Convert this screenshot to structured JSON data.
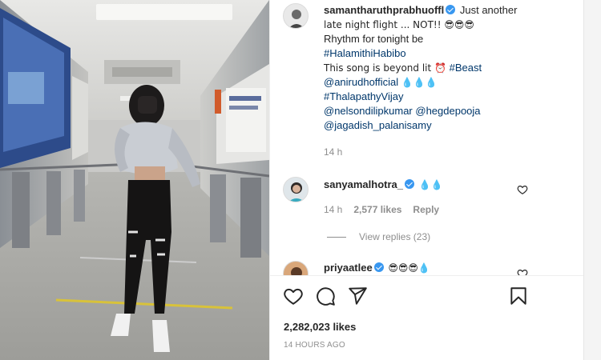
{
  "post": {
    "author": "samantharuthprabhuoffl",
    "caption_lines": [
      {
        "type": "text",
        "text": "Just another"
      },
      {
        "type": "text",
        "text": "late night flight ... NOT!! 😎😎😎"
      },
      {
        "type": "text",
        "text": "Rhythm for tonight be"
      },
      {
        "type": "tag",
        "text": "#HalamithiHabibo"
      },
      {
        "type": "text",
        "text": "This song is beyond lit ⏰"
      },
      {
        "type": "tag",
        "text": "#Beast"
      },
      {
        "type": "tag",
        "text": "@anirudhofficial"
      },
      {
        "type": "text",
        "text": "💧💧💧"
      },
      {
        "type": "tag",
        "text": "#ThalapathyVijay"
      },
      {
        "type": "tag",
        "text": "@nelsondilipkumar"
      },
      {
        "type": "tag",
        "text": "@hegdepooja"
      },
      {
        "type": "tag",
        "text": "@jagadish_palanisamy"
      }
    ],
    "posted_ago": "14 h"
  },
  "comments": [
    {
      "username": "sanyamalhotra_",
      "text": "💧💧",
      "time": "14 h",
      "likes": "2,577 likes",
      "reply_label": "Reply",
      "view_replies": "View replies (23)"
    },
    {
      "username": "priyaatlee",
      "text": "😎😎😎💧"
    }
  ],
  "footer": {
    "likes": "2,282,023 likes",
    "timestamp": "14 HOURS AGO"
  },
  "icons": {
    "like": "heart-icon",
    "comment": "comment-icon",
    "share": "send-icon",
    "save": "bookmark-icon",
    "verified": "verified-badge-icon"
  },
  "colors": {
    "text": "#262626",
    "muted": "#8e8e8e",
    "link": "#00376b",
    "verified": "#3897f0"
  }
}
